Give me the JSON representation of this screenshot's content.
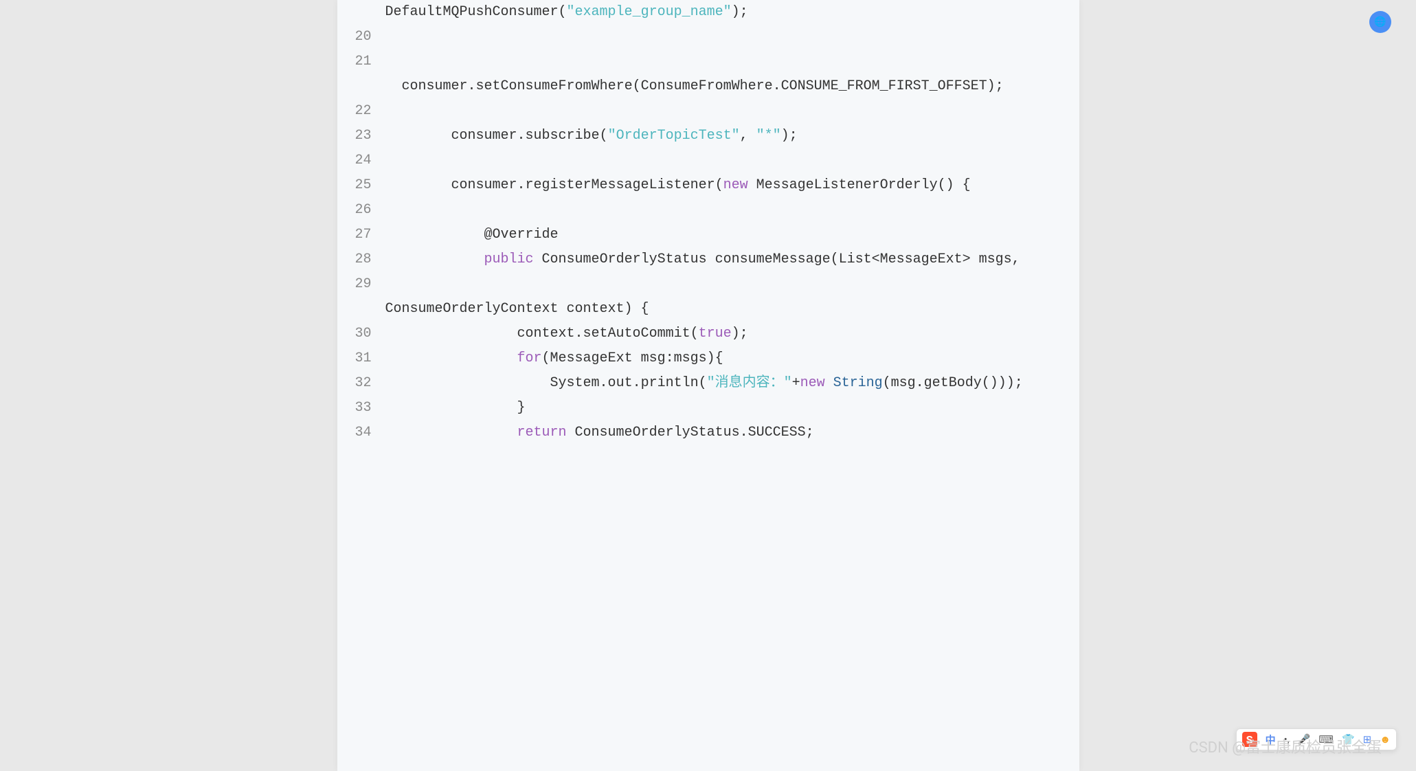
{
  "code": {
    "lines": [
      {
        "num": "",
        "segments": [
          {
            "t": "DefaultMQPushConsumer(",
            "c": ""
          },
          {
            "t": "\"example_group_name\"",
            "c": "str"
          },
          {
            "t": ");",
            "c": ""
          }
        ]
      },
      {
        "num": "20",
        "segments": []
      },
      {
        "num": "21",
        "segments": []
      },
      {
        "num": "",
        "segments": [
          {
            "t": "  consumer.setConsumeFromWhere(ConsumeFromWhere.CONSUME_FROM_FIRST_OFFSET);",
            "c": ""
          }
        ]
      },
      {
        "num": "22",
        "segments": []
      },
      {
        "num": "23",
        "segments": [
          {
            "t": "        consumer.subscribe(",
            "c": ""
          },
          {
            "t": "\"OrderTopicTest\"",
            "c": "str"
          },
          {
            "t": ", ",
            "c": ""
          },
          {
            "t": "\"*\"",
            "c": "str"
          },
          {
            "t": ");",
            "c": ""
          }
        ]
      },
      {
        "num": "24",
        "segments": []
      },
      {
        "num": "25",
        "segments": [
          {
            "t": "        consumer.registerMessageListener(",
            "c": ""
          },
          {
            "t": "new",
            "c": "kw"
          },
          {
            "t": " MessageListenerOrderly() {",
            "c": ""
          }
        ]
      },
      {
        "num": "26",
        "segments": []
      },
      {
        "num": "27",
        "segments": [
          {
            "t": "            @Override",
            "c": "annotation"
          }
        ]
      },
      {
        "num": "28",
        "segments": [
          {
            "t": "            ",
            "c": ""
          },
          {
            "t": "public",
            "c": "kw"
          },
          {
            "t": " ConsumeOrderlyStatus consumeMessage(List<MessageExt> msgs,",
            "c": ""
          }
        ]
      },
      {
        "num": "29",
        "segments": []
      },
      {
        "num": "",
        "segments": [
          {
            "t": "ConsumeOrderlyContext context) {",
            "c": ""
          }
        ]
      },
      {
        "num": "30",
        "segments": [
          {
            "t": "                context.setAutoCommit(",
            "c": ""
          },
          {
            "t": "true",
            "c": "kw"
          },
          {
            "t": ");",
            "c": ""
          }
        ]
      },
      {
        "num": "31",
        "segments": [
          {
            "t": "                ",
            "c": ""
          },
          {
            "t": "for",
            "c": "kw"
          },
          {
            "t": "(MessageExt msg:msgs){",
            "c": ""
          }
        ]
      },
      {
        "num": "32",
        "segments": [
          {
            "t": "                    System.out.println(",
            "c": ""
          },
          {
            "t": "\"消息内容：\"",
            "c": "str"
          },
          {
            "t": "+",
            "c": ""
          },
          {
            "t": "new",
            "c": "kw"
          },
          {
            "t": " ",
            "c": ""
          },
          {
            "t": "String",
            "c": "cls"
          },
          {
            "t": "(msg.getBody()));",
            "c": ""
          }
        ]
      },
      {
        "num": "33",
        "segments": [
          {
            "t": "                }",
            "c": ""
          }
        ]
      },
      {
        "num": "34",
        "segments": [
          {
            "t": "                ",
            "c": ""
          },
          {
            "t": "return",
            "c": "kw"
          },
          {
            "t": " ConsumeOrderlyStatus.SUCCESS;",
            "c": ""
          }
        ]
      }
    ]
  },
  "watermark": "CSDN @富士康质检员张全蛋",
  "ime": {
    "logo": "S",
    "zh": "中",
    "dot": "•,",
    "mic": "🎤",
    "kb": "⌨",
    "cloth": "👕",
    "grid": "⊞",
    "face": "☻"
  },
  "float_icon": "🌐"
}
